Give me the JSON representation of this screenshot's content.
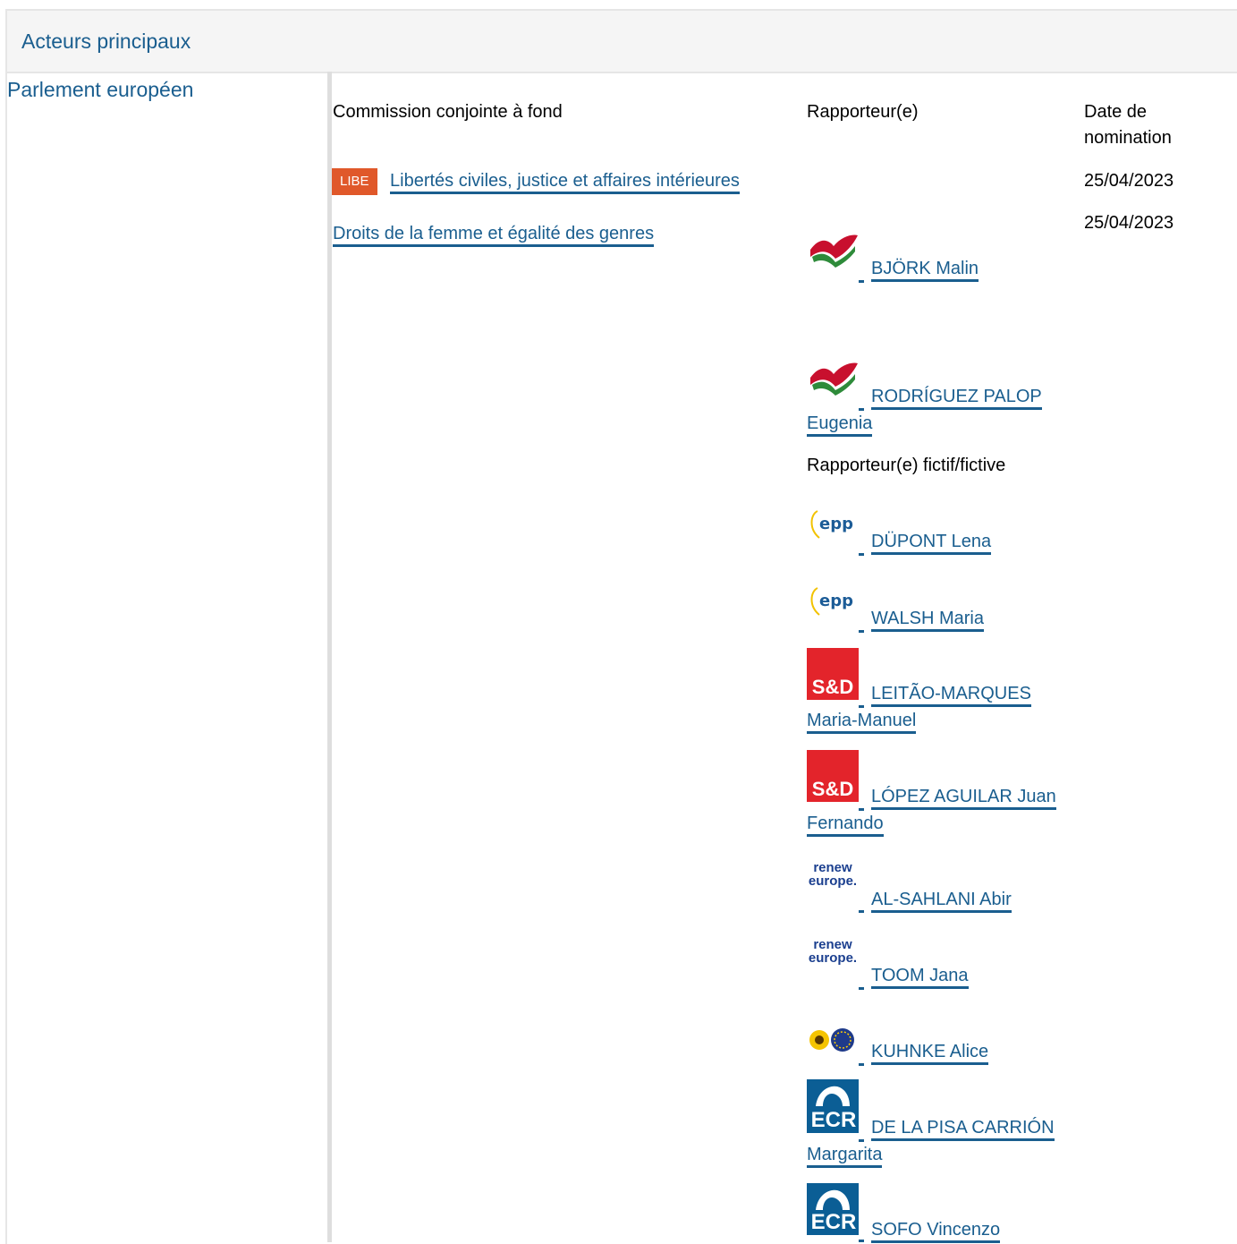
{
  "header": {
    "title": "Acteurs principaux"
  },
  "section": {
    "label": "Parlement européen"
  },
  "columns": {
    "committee": "Commission conjointe à fond",
    "rapporteur": "Rapporteur(e)",
    "date_line1": "Date de",
    "date_line2": "nomination"
  },
  "committees": [
    {
      "badge": "LIBE",
      "name": "Libertés civiles, justice et affaires intérieures",
      "date": "25/04/2023"
    },
    {
      "badge": "",
      "name": "Droits de la femme et égalité des genres",
      "date": "25/04/2023"
    }
  ],
  "rapporteurs": [
    {
      "line1": "BJÖRK Malin",
      "line2": "",
      "group_icon": "gue-ngl-flag-icon"
    },
    {
      "line1": "RODRÍGUEZ PALOP",
      "line2": "Eugenia",
      "group_icon": "gue-ngl-flag-icon"
    }
  ],
  "shadow_label": "Rapporteur(e) fictif/fictive",
  "shadows": [
    {
      "line1": "DÜPONT Lena",
      "line2": "",
      "group_icon": "epp-logo-icon",
      "logo_text": "epp"
    },
    {
      "line1": "WALSH Maria",
      "line2": "",
      "group_icon": "epp-logo-icon",
      "logo_text": "epp"
    },
    {
      "line1": "LEITÃO-MARQUES",
      "line2": "Maria-Manuel",
      "group_icon": "sd-logo-icon",
      "logo_text": "S&D"
    },
    {
      "line1": "LÓPEZ AGUILAR Juan",
      "line2": "Fernando",
      "group_icon": "sd-logo-icon",
      "logo_text": "S&D"
    },
    {
      "line1": "AL-SAHLANI Abir",
      "line2": "",
      "group_icon": "renew-logo-icon",
      "logo_text": "renew europe."
    },
    {
      "line1": "TOOM Jana",
      "line2": "",
      "group_icon": "renew-logo-icon",
      "logo_text": "renew europe."
    },
    {
      "line1": "KUHNKE Alice",
      "line2": "",
      "group_icon": "greens-efa-logo-icon",
      "logo_text": ""
    },
    {
      "line1": "DE LA PISA CARRIÓN",
      "line2": "Margarita",
      "group_icon": "ecr-logo-icon",
      "logo_text": "ECR"
    },
    {
      "line1": "SOFO Vincenzo",
      "line2": "",
      "group_icon": "ecr-logo-icon",
      "logo_text": "ECR"
    }
  ],
  "colors": {
    "link": "#1a5e8f",
    "badge": "#e0582a",
    "sd": "#e3242b",
    "ecr": "#0b5e95"
  }
}
